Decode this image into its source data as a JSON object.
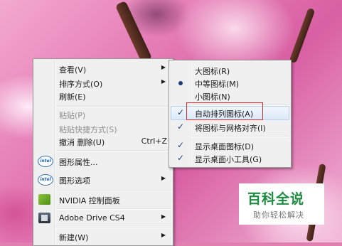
{
  "context_menu": {
    "items": [
      {
        "label": "查看(V)",
        "submenu": true
      },
      {
        "label": "排序方式(O)",
        "submenu": true
      },
      {
        "label": "刷新(E)"
      },
      {
        "label": "粘贴(P)",
        "disabled": true
      },
      {
        "label": "粘贴快捷方式(S)",
        "disabled": true
      },
      {
        "label": "撤消 删除(U)",
        "shortcut": "Ctrl+Z"
      },
      {
        "label": "图形属性...",
        "icon": "intel-icon"
      },
      {
        "label": "图形选项",
        "icon": "intel-icon",
        "submenu": true
      },
      {
        "label": "NVIDIA 控制面板",
        "icon": "nvidia-icon"
      },
      {
        "label": "Adobe Drive CS4",
        "icon": "adobe-drive-icon",
        "submenu": true
      },
      {
        "label": "新建(W)",
        "submenu": true
      }
    ],
    "arrow_glyph": "▶"
  },
  "view_submenu": {
    "items": [
      {
        "label": "大图标(R)"
      },
      {
        "label": "中等图标(M)",
        "selected": true
      },
      {
        "label": "小图标(N)"
      },
      {
        "label": "自动排列图标(A)",
        "checked": true,
        "highlighted": true
      },
      {
        "label": "将图标与网格对齐(I)",
        "checked": true
      },
      {
        "label": "显示桌面图标(D)",
        "checked": true
      },
      {
        "label": "显示桌面小工具(G)",
        "checked": true
      }
    ],
    "check_glyph": "✓"
  },
  "icon_text": {
    "intel": "intel"
  },
  "watermark": {
    "title": "百科全说",
    "subtitle": "助你轻松解决"
  },
  "colors": {
    "annotation_box": "#d92c2c",
    "watermark_green": "#1c8a3f",
    "highlight": "#dce9f9"
  }
}
